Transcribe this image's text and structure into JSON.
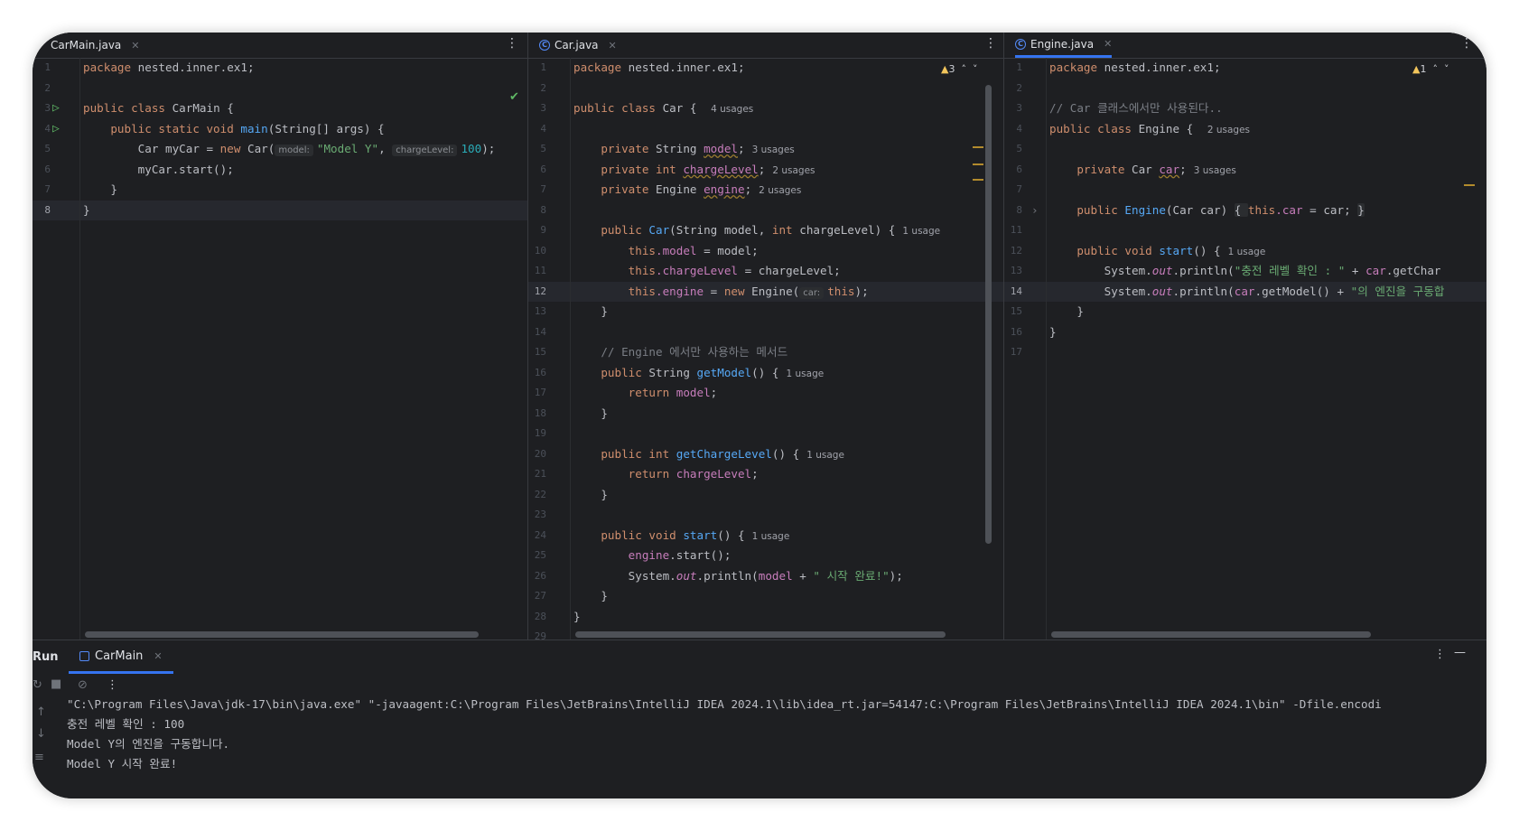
{
  "colors": {
    "background": "#1e1f22",
    "accent": "#3574f0",
    "keyword": "#cf8e6d",
    "string": "#6aab73",
    "number": "#2aacb8",
    "method": "#56a8f5",
    "field": "#c77dbb",
    "comment": "#7a7e85",
    "warning": "#f2c55c"
  },
  "editor": {
    "carmain": {
      "tab": "CarMain.java",
      "nums": [
        "1",
        "2",
        "3",
        "4",
        "5",
        "6",
        "7",
        "8"
      ],
      "l1": "package nested.inner.ex1;",
      "l3a": "public class ",
      "l3b": "CarMain {",
      "l4a": "    public static void ",
      "l4b": "main",
      "l4c": "(String[] args) {",
      "l5a": "        Car myCar = ",
      "l5b": "new ",
      "l5c": "Car(",
      "l5hint1": "model:",
      "l5str": "\"Model Y\"",
      ", ": ", ",
      "l5hint2": "chargeLevel:",
      "l5num": "100",
      "l5end": ");",
      "l6": "        myCar.start();",
      "l7": "    }",
      "l8": "}"
    },
    "car": {
      "tab": "Car.java",
      "warnings": "3",
      "nums": [
        "1",
        "2",
        "3",
        "4",
        "5",
        "6",
        "7",
        "8",
        "9",
        "10",
        "11",
        "12",
        "13",
        "14",
        "15",
        "16",
        "17",
        "18",
        "19",
        "20",
        "21",
        "22",
        "23",
        "24",
        "25",
        "26",
        "27",
        "28",
        "29"
      ],
      "l1": "package nested.inner.ex1;",
      "l3a": "public class ",
      "l3b": "Car { ",
      "l3u": "4 usages",
      "l5a": "    private ",
      "l5b": "String ",
      "l5c": "model",
      "l5d": ";",
      "l5u": "3 usages",
      "l6a": "    private int ",
      "l6c": "chargeLevel",
      "l6d": ";",
      "l6u": "2 usages",
      "l7a": "    private ",
      "l7b": "Engine ",
      "l7c": "engine",
      "l7d": ";",
      "l7u": "2 usages",
      "l9a": "    public ",
      "l9b": "Car",
      "l9c": "(String model, ",
      "l9d": "int ",
      "l9e": "chargeLevel) {",
      "l9u": "1 usage",
      "l10a": "        this",
      "l10b": ".model",
      " = model;": " = model;",
      "l11a": "        this",
      "l11b": ".chargeLevel",
      "l11c": " = chargeLevel;",
      "l12a": "        this",
      "l12b": ".engine",
      "l12c": " = ",
      "l12d": "new ",
      "l12e": "Engine(",
      "l12hint": "car:",
      "l12f": "this",
      "l12g": ");",
      "l13": "    }",
      "l15": "    // Engine 에서만 사용하는 메서드",
      "l16a": "    public ",
      "l16b": "String ",
      "l16c": "getModel",
      "l16d": "() {",
      "l16u": "1 usage",
      "l17a": "        return ",
      "l17b": "model",
      ";": ";",
      "l18": "    }",
      "l20a": "    public int ",
      "l20c": "getChargeLevel",
      "l20d": "() {",
      "l20u": "1 usage",
      "l21a": "        return ",
      "l21b": "chargeLevel",
      "l22": "    }",
      "l24a": "    public void ",
      "l24c": "start",
      "l24d": "() {",
      "l24u": "1 usage",
      "l25a": "        ",
      "l25b": "engine",
      ".start();": ".start();",
      "l26a": "        System.",
      "l26b": "out",
      "l26c": ".println(",
      "l26d": "model",
      " + ": " + ",
      "l26e": "\" 시작 완료!\"",
      "l26f": ");",
      "l27": "    }",
      "l28": "}"
    },
    "engine": {
      "tab": "Engine.java",
      "warnings": "1",
      "nums": [
        "1",
        "2",
        "3",
        "4",
        "5",
        "6",
        "7",
        "8",
        "11",
        "12",
        "13",
        "14",
        "15",
        "16",
        "17"
      ],
      "l1": "package nested.inner.ex1;",
      "l3": "// Car 클래스에서만 사용된다..",
      "l4a": "public class ",
      "l4b": "Engine { ",
      "l4u": "2 usages",
      "l6a": "    private ",
      "l6b": "Car ",
      "l6c": "car",
      "l6d": ";",
      "l6u": "3 usages",
      "l8a": "    public ",
      "l8b": "Engine",
      "l8c": "(Car car) ",
      "l8d": "{ ",
      "l8e": "this",
      ".car": ".car",
      " = car; ": " = car; ",
      "l8f": "}",
      "l12a": "    public void ",
      "l12c": "start",
      "l12d": "() {",
      "l12u": "1 usage",
      "l13a": "        System.",
      "l13b": "out",
      "l13c": ".println(",
      "l13d": "\"충전 레벨 확인 : \"",
      "l13e": " + ",
      "l13f": "car",
      ".getChar": ".getChar",
      "l14a": "        System.",
      "l14b": "out",
      "l14c": ".println(",
      "l14d": "car",
      "l14e": ".getModel() + ",
      "l14f": "\"의 엔진을 구동합",
      "l15": "    }",
      "l16": "}"
    }
  },
  "run": {
    "title": "Run",
    "tab": "CarMain",
    "output": [
      "\"C:\\Program Files\\Java\\jdk-17\\bin\\java.exe\" \"-javaagent:C:\\Program Files\\JetBrains\\IntelliJ IDEA 2024.1\\lib\\idea_rt.jar=54147:C:\\Program Files\\JetBrains\\IntelliJ IDEA 2024.1\\bin\" -Dfile.encodi",
      "충전 레벨 확인 : 100",
      "Model Y의 엔진을 구동합니다.",
      "Model Y 시작 완료!"
    ]
  }
}
